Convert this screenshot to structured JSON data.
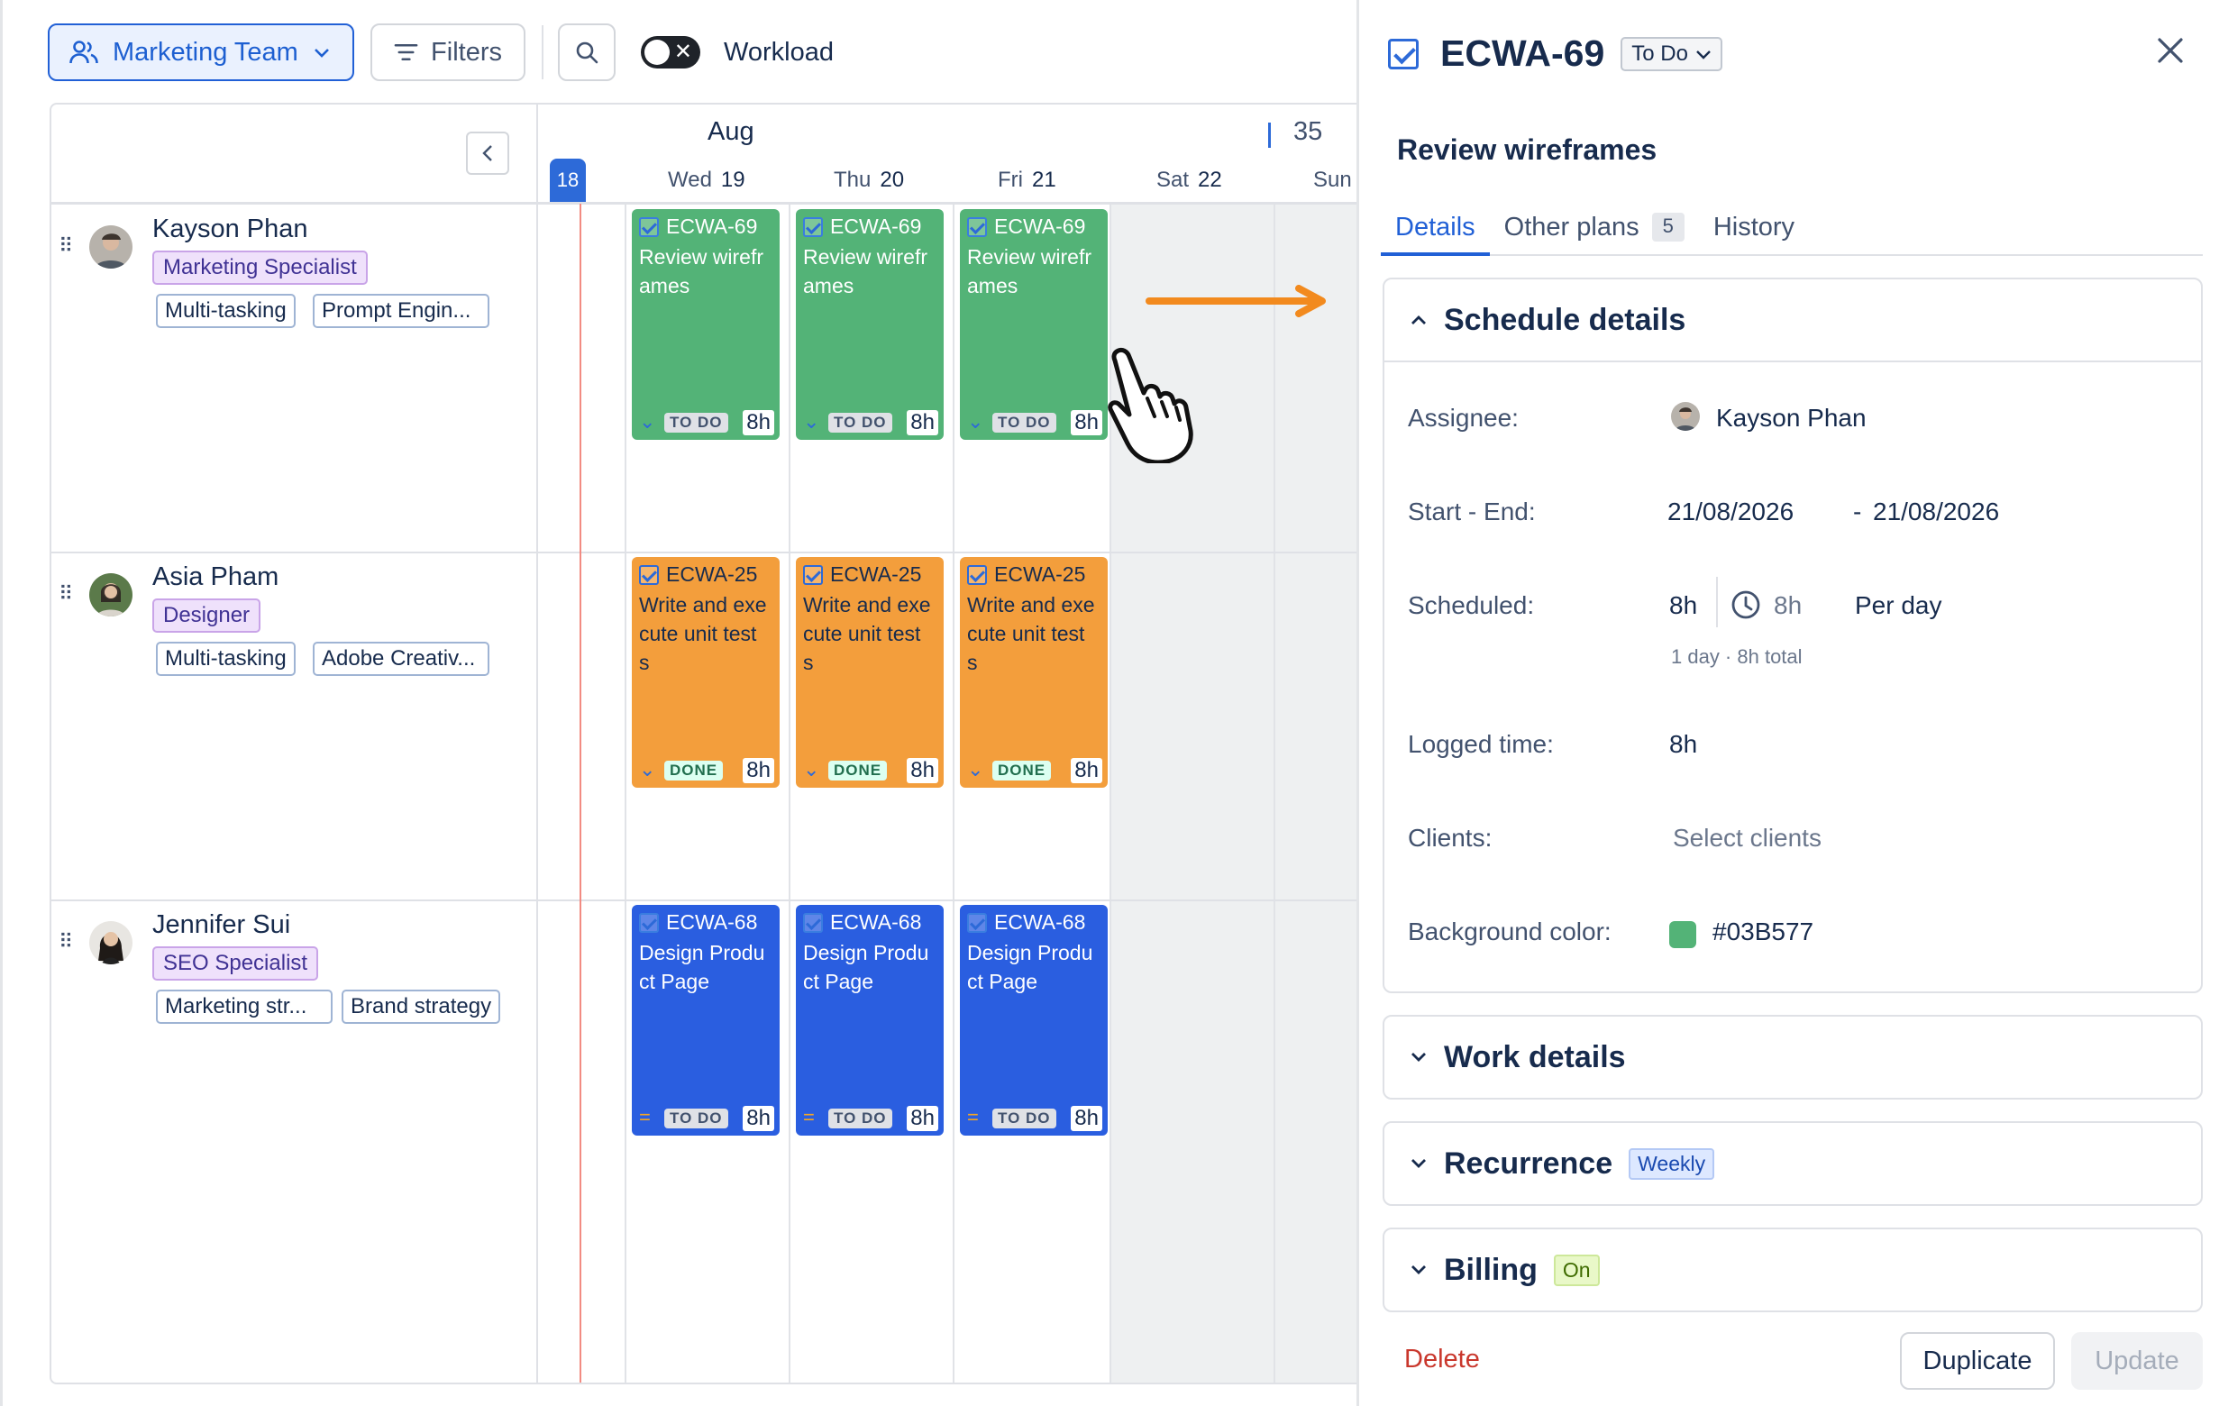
{
  "toolbar": {
    "team_label": "Marketing Team",
    "filters_label": "Filters",
    "workload_label": "Workload",
    "workload_on": false
  },
  "calendar": {
    "month": "Aug",
    "week_number": "35",
    "today": "18",
    "days": [
      {
        "name": "Wed",
        "num": "19"
      },
      {
        "name": "Thu",
        "num": "20"
      },
      {
        "name": "Fri",
        "num": "21"
      },
      {
        "name": "Sat",
        "num": "22"
      },
      {
        "name": "Sun",
        "num": ""
      }
    ]
  },
  "resources": [
    {
      "name": "Kayson Phan",
      "role": "Marketing Specialist",
      "skills": [
        "Multi-tasking",
        "Prompt Engin..."
      ]
    },
    {
      "name": "Asia Pham",
      "role": "Designer",
      "skills": [
        "Multi-tasking",
        "Adobe Creativ..."
      ]
    },
    {
      "name": "Jennifer Sui",
      "role": "SEO Specialist",
      "skills": [
        "Marketing str...",
        "Brand strategy"
      ]
    }
  ],
  "tasks": [
    {
      "key": "ECWA-69",
      "title": "Review wirefr ames",
      "status": "TO DO",
      "hours": "8h",
      "color": "#53B377"
    },
    {
      "key": "ECWA-25",
      "title": "Write and exe cute unit test s",
      "status": "DONE",
      "hours": "8h",
      "color": "#F39E3C"
    },
    {
      "key": "ECWA-68",
      "title": "Design Produ ct Page",
      "status": "TO DO",
      "hours": "8h",
      "color": "#2A5EE0"
    }
  ],
  "panel": {
    "key": "ECWA-69",
    "status": "To Do",
    "title": "Review wireframes",
    "tabs": {
      "details": "Details",
      "other_plans": "Other plans",
      "other_plans_count": "5",
      "history": "History"
    },
    "schedule": {
      "heading": "Schedule details",
      "assignee_label": "Assignee:",
      "assignee": "Kayson Phan",
      "start_end_label": "Start - End:",
      "start": "21/08/2026",
      "end_sep": "-",
      "end": "21/08/2026",
      "scheduled_label": "Scheduled:",
      "scheduled_hours": "8h",
      "scheduled_per": "8h",
      "scheduled_unit": "Per day",
      "scheduled_summary": "1 day · 8h total",
      "logged_label": "Logged time:",
      "logged": "8h",
      "clients_label": "Clients:",
      "clients_placeholder": "Select clients",
      "bg_label": "Background color:",
      "bg_value": "#03B577"
    },
    "work_details": "Work details",
    "recurrence": "Recurrence",
    "recurrence_badge": "Weekly",
    "billing": "Billing",
    "billing_badge": "On",
    "delete_label": "Delete",
    "duplicate_label": "Duplicate",
    "update_label": "Update"
  },
  "colors": {
    "accent": "#2160D6",
    "drag_arrow": "#F28A1E",
    "today": "#2D6AD8"
  }
}
